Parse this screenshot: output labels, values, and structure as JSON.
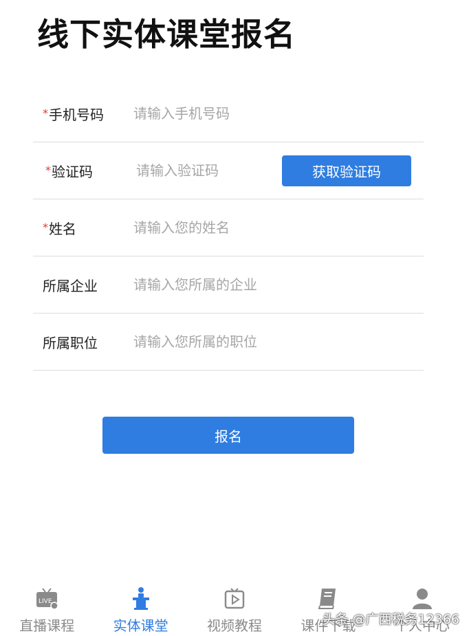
{
  "page": {
    "title": "线下实体课堂报名"
  },
  "form": {
    "required_mark": "*",
    "fields": [
      {
        "label": "手机号码",
        "placeholder": "请输入手机号码",
        "required": true
      },
      {
        "label": "验证码",
        "placeholder": "请输入验证码",
        "required": true
      },
      {
        "label": "姓名",
        "placeholder": "请输入您的姓名",
        "required": true
      },
      {
        "label": "所属企业",
        "placeholder": "请输入您所属的企业",
        "required": false
      },
      {
        "label": "所属职位",
        "placeholder": "请输入您所属的职位",
        "required": false
      }
    ],
    "get_code_label": "获取验证码",
    "submit_label": "报名"
  },
  "tabbar": {
    "items": [
      {
        "label": "直播课程",
        "icon": "live-tv-icon",
        "active": false
      },
      {
        "label": "实体课堂",
        "icon": "lectern-icon",
        "active": true
      },
      {
        "label": "视频教程",
        "icon": "video-icon",
        "active": false
      },
      {
        "label": "课件下载",
        "icon": "book-icon",
        "active": false
      },
      {
        "label": "个人中心",
        "icon": "user-icon",
        "active": false
      }
    ]
  },
  "watermark": "头条 @广西税务12366",
  "colors": {
    "accent": "#2f7de1",
    "required": "#e53935",
    "inactive": "#8a8a8a",
    "divider": "#dcdcdc"
  }
}
